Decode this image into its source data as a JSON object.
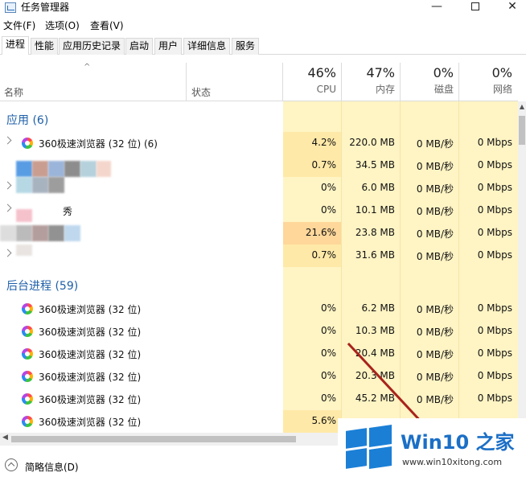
{
  "window": {
    "title": "任务管理器",
    "min_glyph": "—",
    "close_glyph": "✕"
  },
  "menu": [
    "文件(F)",
    "选项(O)",
    "查看(V)"
  ],
  "tabs": [
    "进程",
    "性能",
    "应用历史记录",
    "启动",
    "用户",
    "详细信息",
    "服务"
  ],
  "header": {
    "sort_arrow": "^",
    "name": "名称",
    "status": "状态",
    "cpu": {
      "pct": "46%",
      "label": "CPU"
    },
    "memory": {
      "pct": "47%",
      "label": "内存"
    },
    "disk": {
      "pct": "0%",
      "label": "磁盘"
    },
    "network": {
      "pct": "0%",
      "label": "网络"
    }
  },
  "sections": {
    "apps": "应用 (6)",
    "background": "后台进程 (59)"
  },
  "apps": [
    {
      "name": "360极速浏览器 (32 位) (6)",
      "cpu": "4.2%",
      "mem": "220.0 MB",
      "disk": "0 MB/秒",
      "net": "0 Mbps"
    },
    {
      "name": "",
      "cpu": "0.7%",
      "mem": "34.5 MB",
      "disk": "0 MB/秒",
      "net": "0 Mbps"
    },
    {
      "name": "",
      "cpu": "0%",
      "mem": "6.0 MB",
      "disk": "0 MB/秒",
      "net": "0 Mbps"
    },
    {
      "name": "秀",
      "cpu": "0%",
      "mem": "10.1 MB",
      "disk": "0 MB/秒",
      "net": "0 Mbps"
    },
    {
      "name": "",
      "cpu": "21.6%",
      "mem": "23.8 MB",
      "disk": "0 MB/秒",
      "net": "0 Mbps"
    },
    {
      "name": "",
      "cpu": "0.7%",
      "mem": "31.6 MB",
      "disk": "0 MB/秒",
      "net": "0 Mbps"
    }
  ],
  "background": [
    {
      "name": "360极速浏览器 (32 位)",
      "cpu": "0%",
      "mem": "6.2 MB",
      "disk": "0 MB/秒",
      "net": "0 Mbps"
    },
    {
      "name": "360极速浏览器 (32 位)",
      "cpu": "0%",
      "mem": "10.3 MB",
      "disk": "0 MB/秒",
      "net": "0 Mbps"
    },
    {
      "name": "360极速浏览器 (32 位)",
      "cpu": "0%",
      "mem": "20.4 MB",
      "disk": "0 MB/秒",
      "net": "0 Mbps"
    },
    {
      "name": "360极速浏览器 (32 位)",
      "cpu": "0%",
      "mem": "20.3 MB",
      "disk": "0 MB/秒",
      "net": "0 Mbps"
    },
    {
      "name": "360极速浏览器 (32 位)",
      "cpu": "0%",
      "mem": "45.2 MB",
      "disk": "0 MB/秒",
      "net": "0 Mbps"
    },
    {
      "name": "360极速浏览器 (32 位)",
      "cpu": "5.6%",
      "mem": "",
      "disk": "",
      "net": ""
    }
  ],
  "footer": {
    "fewer_details": "简略信息(D)"
  },
  "watermark": {
    "title": "Win10 之家",
    "url": "www.win10xitong.com"
  },
  "colors": {
    "accent": "#1e5fa8",
    "cpu_hot": "#ffd79a",
    "column_bg": "#fff4c4",
    "arrow": "#a8231c"
  }
}
